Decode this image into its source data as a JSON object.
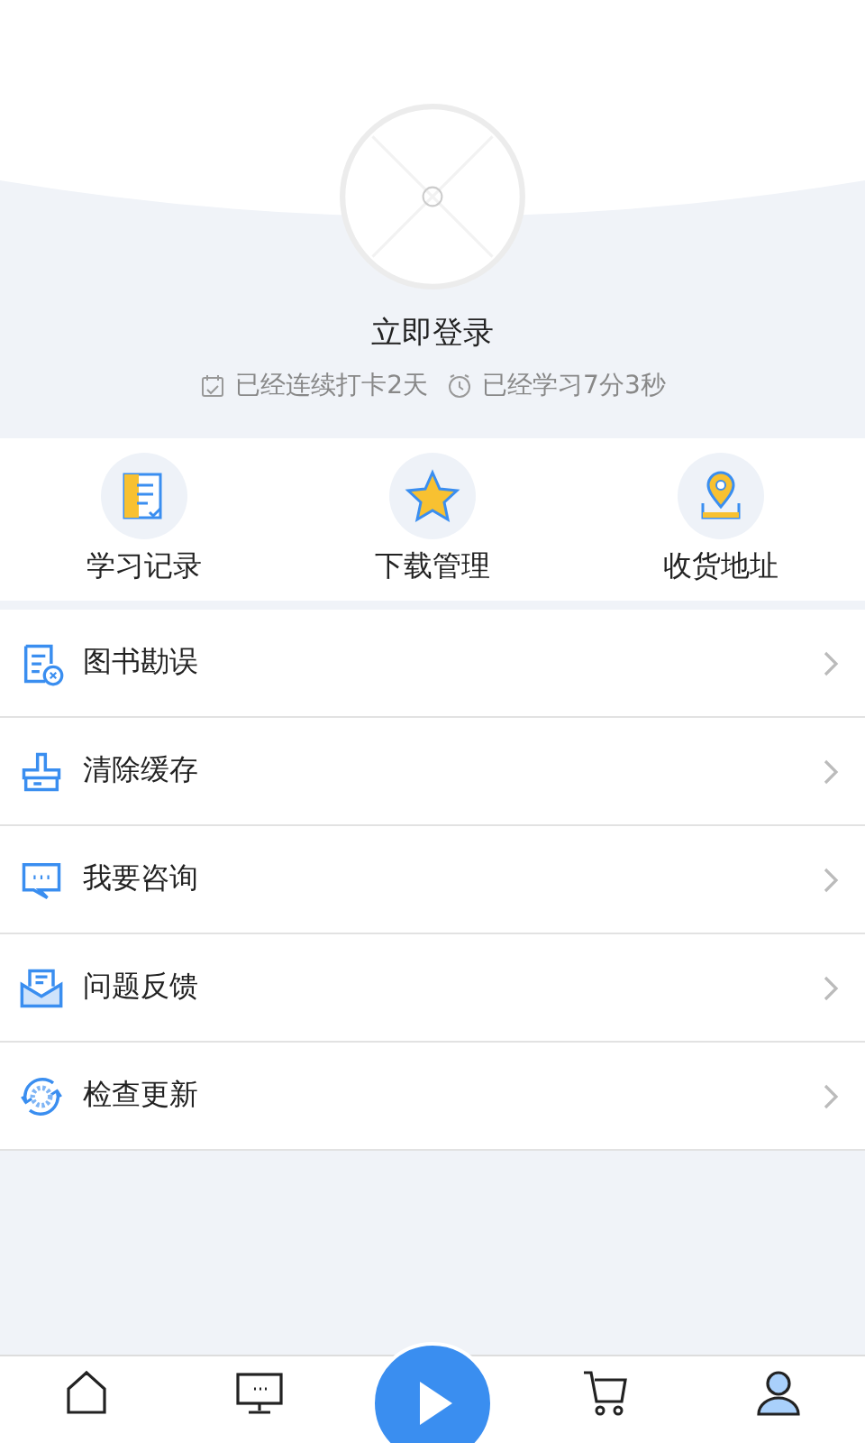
{
  "profile": {
    "login": "立即登录",
    "streak": "已经连续打卡2天",
    "study_time": "已经学习7分3秒"
  },
  "shortcuts": [
    {
      "label": "学习记录",
      "kind": "record"
    },
    {
      "label": "下载管理",
      "kind": "star"
    },
    {
      "label": "收货地址",
      "kind": "pin"
    }
  ],
  "menu": [
    {
      "label": "图书勘误",
      "kind": "errata"
    },
    {
      "label": "清除缓存",
      "kind": "broom"
    },
    {
      "label": "我要咨询",
      "kind": "chat"
    },
    {
      "label": "问题反馈",
      "kind": "mail"
    },
    {
      "label": "检查更新",
      "kind": "refresh"
    }
  ],
  "tab_bar": [
    {
      "kind": "home",
      "selected": false
    },
    {
      "kind": "monitor",
      "selected": false
    },
    {
      "kind": "play",
      "selected": false
    },
    {
      "kind": "cart",
      "selected": false
    },
    {
      "kind": "user",
      "selected": true
    }
  ]
}
